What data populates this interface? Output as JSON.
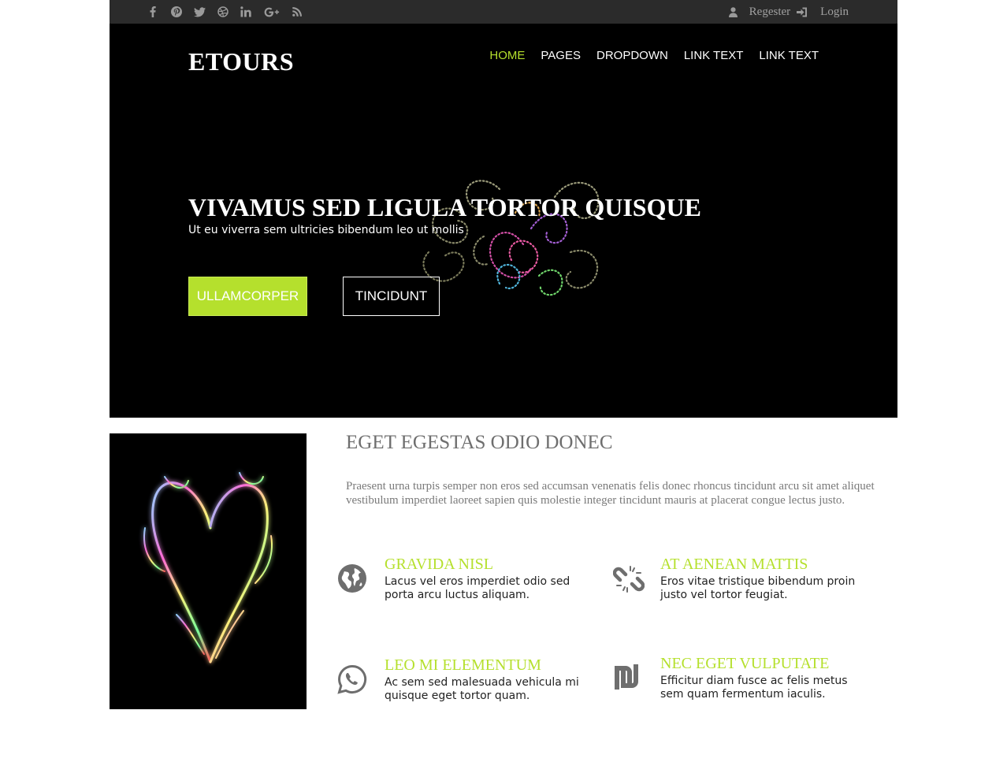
{
  "colors": {
    "accent": "#b5e02d",
    "topbar": "#2b2b2b",
    "hero_bg": "#000000",
    "muted_text": "#7a7a7a"
  },
  "topbar": {
    "social_icons": [
      "facebook-icon",
      "pinterest-icon",
      "twitter-icon",
      "dribbble-icon",
      "linkedin-icon",
      "google-plus-icon",
      "rss-icon"
    ],
    "register_label": "Regester",
    "login_label": "Login"
  },
  "header": {
    "logo": "ETOURS",
    "nav": [
      "HOME",
      "PAGES",
      "DROPDOWN",
      "LINK TEXT",
      "LINK TEXT"
    ],
    "active_nav": "HOME"
  },
  "hero": {
    "title": "VIVAMUS SED LIGULA TORTOR QUISQUE",
    "subtitle": "Ut eu viverra sem ultricies bibendum leo ut mollis",
    "primary_button": "ULLAMCORPER",
    "secondary_button": "TINCIDUNT"
  },
  "about": {
    "title": "EGET EGESTAS ODIO DONEC",
    "text": "Praesent urna turpis semper non eros sed accumsan venenatis felis donec rhoncus tincidunt arcu sit amet aliquet vestibulum imperdiet laoreet sapien quis molestie integer tincidunt mauris at placerat congue lectus justo."
  },
  "features": [
    {
      "icon": "globe-icon",
      "title": "GRAVIDA NISL",
      "text": "Lacus vel eros imperdiet odio sed porta arcu luctus aliquam."
    },
    {
      "icon": "broken-link-icon",
      "title": "AT AENEAN MATTIS",
      "text": "Eros vitae tristique bibendum proin justo vel tortor feugiat."
    },
    {
      "icon": "whatsapp-icon",
      "title": "LEO MI ELEMENTUM",
      "text": "Ac sem sed malesuada vehicula mi quisque eget tortor quam."
    },
    {
      "icon": "shekel-icon",
      "title": "NEC EGET VULPUTATE",
      "text": "Efficitur diam fusce ac felis metus sem quam fermentum iaculis."
    }
  ]
}
